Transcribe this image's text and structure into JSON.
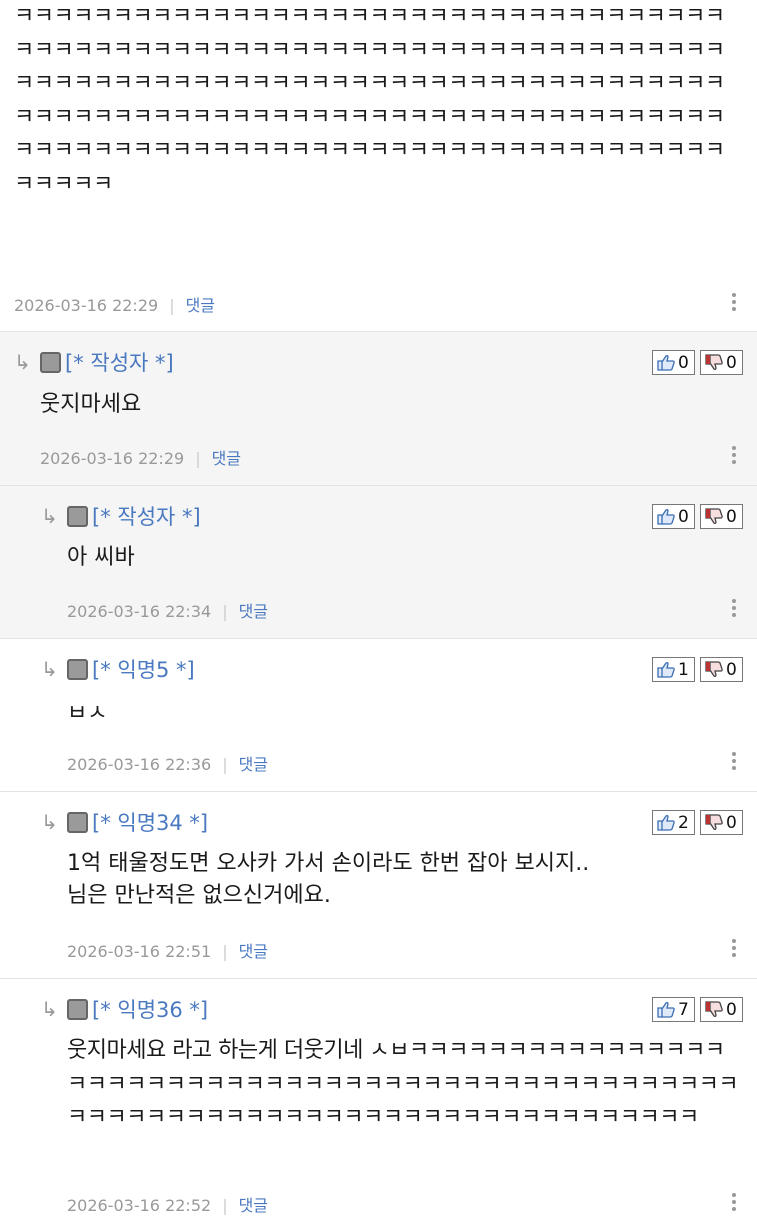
{
  "top_post": {
    "text": "ㅋㅋㅋㅋㅋㅋㅋㅋㅋㅋㅋㅋㅋㅋㅋㅋㅋㅋㅋㅋㅋㅋㅋㅋㅋㅋㅋㅋㅋㅋㅋㅋㅋㅋㅋㅋㅋㅋㅋㅋㅋㅋㅋㅋㅋㅋㅋㅋㅋㅋㅋㅋㅋㅋㅋㅋㅋㅋㅋㅋㅋㅋㅋㅋㅋㅋㅋㅋㅋㅋㅋㅋㅋㅋㅋㅋㅋㅋㅋㅋㅋㅋㅋㅋㅋㅋㅋㅋㅋㅋㅋㅋㅋㅋㅋㅋㅋㅋㅋㅋㅋㅋㅋㅋㅋㅋㅋㅋㅋㅋㅋㅋㅋㅋㅋㅋㅋㅋㅋㅋㅋㅋㅋㅋㅋㅋㅋㅋㅋㅋㅋㅋㅋㅋㅋㅋㅋㅋㅋㅋㅋㅋㅋㅋㅋㅋㅋㅋㅋㅋㅋㅋㅋㅋㅋㅋㅋㅋㅋㅋㅋㅋㅋㅋㅋㅋㅋㅋㅋㅋㅋㅋㅋㅋㅋㅋㅋㅋㅋㅋㅋㅋㅋㅋㅋ",
    "timestamp": "2026-03-16 22:29",
    "reply_label": "댓글"
  },
  "comments": [
    {
      "author": "[* 작성자 *]",
      "text": "웃지마세요",
      "timestamp": "2026-03-16 22:29",
      "reply_label": "댓글",
      "likes": "0",
      "dislikes": "0"
    },
    {
      "author": "[* 작성자 *]",
      "text": "아 씨바",
      "timestamp": "2026-03-16 22:34",
      "reply_label": "댓글",
      "likes": "0",
      "dislikes": "0"
    },
    {
      "author": "[* 익명5 *]",
      "text": "ㅂㅅ",
      "timestamp": "2026-03-16 22:36",
      "reply_label": "댓글",
      "likes": "1",
      "dislikes": "0"
    },
    {
      "author": "[* 익명34 *]",
      "text": "1억 태울정도면 오사카 가서 손이라도 한번 잡아 보시지..\n님은 만난적은 없으신거에요.",
      "timestamp": "2026-03-16 22:51",
      "reply_label": "댓글",
      "likes": "2",
      "dislikes": "0"
    },
    {
      "author": "[* 익명36 *]",
      "text": "웃지마세요 라고 하는게 더웃기네 ㅅㅂㅋㅋㅋㅋㅋㅋㅋㅋㅋㅋㅋㅋㅋㅋㅋㅋㅋㅋㅋㅋㅋㅋㅋㅋㅋㅋㅋㅋㅋㅋㅋㅋㅋㅋㅋㅋㅋㅋㅋㅋㅋㅋㅋㅋㅋㅋㅋㅋㅋㅋㅋㅋㅋㅋㅋㅋㅋㅋㅋㅋㅋㅋㅋㅋㅋㅋㅋㅋㅋㅋㅋㅋㅋㅋㅋㅋㅋㅋㅋㅋㅋㅋ",
      "timestamp": "2026-03-16 22:52",
      "reply_label": "댓글",
      "likes": "7",
      "dislikes": "0"
    }
  ],
  "icons": {
    "reply_arrow": "reply-arrow-icon",
    "avatar": "avatar-icon",
    "like": "thumbs-up-icon",
    "dislike": "thumbs-down-icon",
    "more": "more-vertical-icon"
  },
  "colors": {
    "accent": "#4a79c0",
    "meta": "#999999",
    "shade": "#f5f5f5"
  }
}
